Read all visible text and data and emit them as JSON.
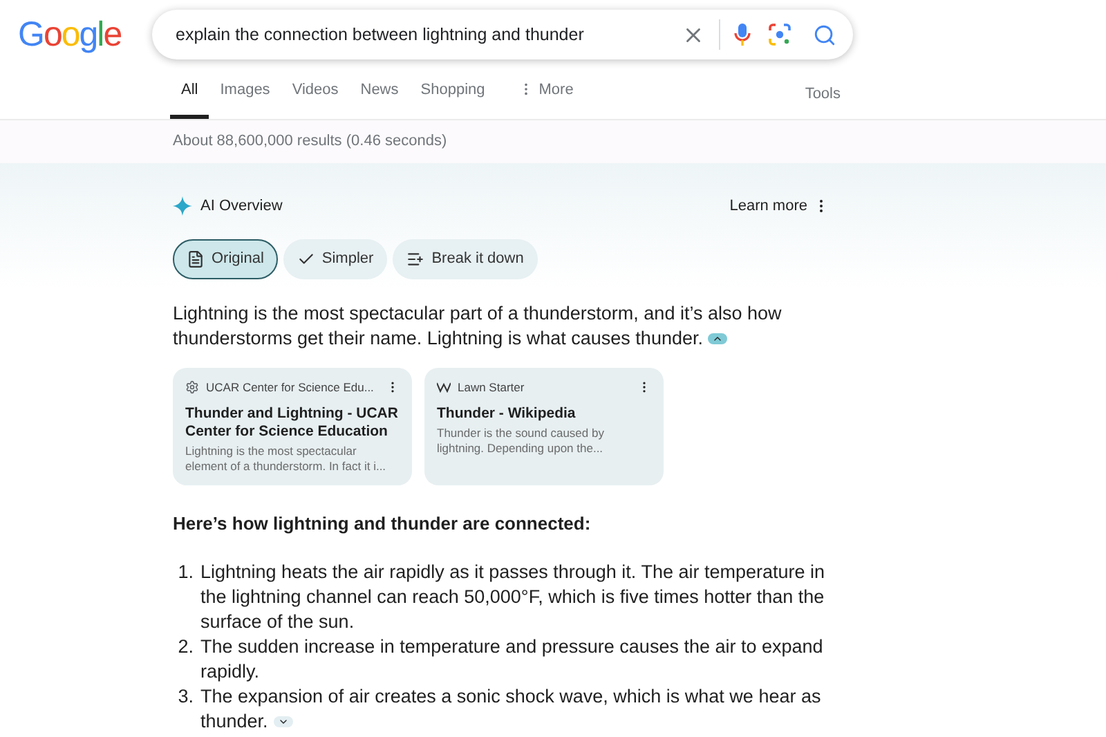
{
  "logo": "Google",
  "search": {
    "value": "explain the connection between lightning and thunder"
  },
  "tabs": [
    {
      "label": "All",
      "selected": true
    },
    {
      "label": "Images",
      "selected": false
    },
    {
      "label": "Videos",
      "selected": false
    },
    {
      "label": "News",
      "selected": false
    },
    {
      "label": "Shopping",
      "selected": false
    },
    {
      "label": "More",
      "selected": false,
      "kind": "more"
    }
  ],
  "tools": "Tools",
  "result_stats": "About 88,600,000 results (0.46 seconds)",
  "ai_overview": {
    "title": "AI Overview",
    "learn_more": "Learn more",
    "modes": [
      {
        "label": "Original",
        "selected": true,
        "kind": "doc"
      },
      {
        "label": "Simpler",
        "selected": false,
        "kind": "check"
      },
      {
        "label": "Break it down",
        "selected": false,
        "kind": "list"
      }
    ],
    "summary": "Lightning is the most spectacular part of a thunderstorm, and it’s also how thunderstorms get their name. Lightning is what causes thunder.",
    "sources": [
      {
        "site": "UCAR Center for Science Edu...",
        "kind": "gear",
        "title": "Thunder and Lightning - UCAR Center for Science Education",
        "snippet": "Lightning is the most spectacular element of a thunderstorm. In fact it i..."
      },
      {
        "site": "Lawn Starter",
        "kind": "wiki",
        "title": "Thunder - Wikipedia",
        "snippet": "Thunder is the sound caused by lightning. Depending upon the..."
      }
    ],
    "heading": "Here’s how lightning and thunder are connected:",
    "steps": [
      {
        "number": "1.",
        "text": "Lightning heats the air rapidly as it passes through it. The air temperature in the lightning channel can reach 50,000°F, which is five times hotter than the surface of the sun."
      },
      {
        "number": "2.",
        "text": "The sudden increase in temperature and pressure causes the air to expand rapidly."
      },
      {
        "number": "3.",
        "text": "The expansion of air creates a sonic shock wave, which is what we hear as thunder."
      }
    ]
  }
}
